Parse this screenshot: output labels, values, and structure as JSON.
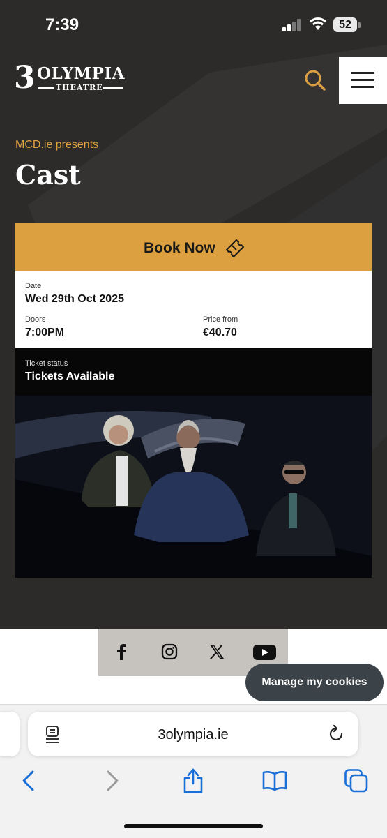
{
  "status_bar": {
    "time": "7:39",
    "battery": "52"
  },
  "header": {
    "logo_three": "3",
    "logo_name": "OLYMPIA",
    "logo_sub": "THEATRE"
  },
  "event": {
    "presenter": "MCD.ie presents",
    "title": "Cast",
    "book_label": "Book Now",
    "date_label": "Date",
    "date_value": "Wed 29th Oct 2025",
    "doors_label": "Doors",
    "doors_value": "7:00PM",
    "price_label": "Price from",
    "price_value": "€40.70",
    "ticket_status_label": "Ticket status",
    "ticket_status_value": "Tickets Available"
  },
  "social": [
    "facebook-icon",
    "instagram-icon",
    "x-icon",
    "youtube-icon"
  ],
  "cookies_label": "Manage my cookies",
  "browser": {
    "url": "3olympia.ie"
  },
  "colors": {
    "accent": "#dda041",
    "background": "#2c2b2a",
    "presenter": "#e0a23e"
  }
}
